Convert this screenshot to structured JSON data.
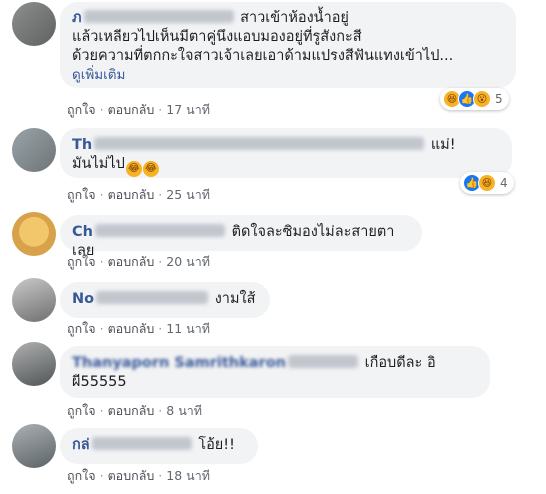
{
  "comments": [
    {
      "author_prefix": "ภ",
      "lines": [
        "สาวเข้าห้องน้ำอยู่",
        "แล้วเหลียวไปเห็นมีตาคู่นึงแอบมองอยู่ที่รูสังกะสี",
        "ด้วยความที่ตกกะใจสาวเจ้าเลยเอาด้ามแปรงสีฟันแทงเข้าไป..."
      ],
      "see_more": "ดูเพิ่มเติม",
      "like": "ถูกใจ",
      "reply": "ตอบกลับ",
      "time": "17 นาที",
      "reactions": [
        "haha-icon",
        "like-icon",
        "wow-icon"
      ],
      "reaction_count": "5"
    },
    {
      "author_prefix": "Th",
      "lines": [
        "แม่!",
        "มันไม่ไป"
      ],
      "like": "ถูกใจ",
      "reply": "ตอบกลับ",
      "time": "25 นาที",
      "reactions": [
        "like-icon",
        "haha-icon"
      ],
      "reaction_count": "4"
    },
    {
      "author_prefix": "Ch",
      "lines": [
        "ติดใจละซิมองไม่ละสายตาเลย"
      ],
      "like": "ถูกใจ",
      "reply": "ตอบกลับ",
      "time": "20 นาที"
    },
    {
      "author_prefix": "No",
      "lines": [
        "งามใส้"
      ],
      "like": "ถูกใจ",
      "reply": "ตอบกลับ",
      "time": "11 นาที"
    },
    {
      "author_prefix": "Thanyaporn Samrithkaron",
      "lines": [
        "เกือบดีละ อิ",
        "ผี55555"
      ],
      "like": "ถูกใจ",
      "reply": "ตอบกลับ",
      "time": "8 นาที"
    },
    {
      "author_prefix": "กล่",
      "lines": [
        "โอ้ย!!"
      ],
      "like": "ถูกใจ",
      "reply": "ตอบกลับ",
      "time": "18 นาที"
    }
  ],
  "separator": "·"
}
